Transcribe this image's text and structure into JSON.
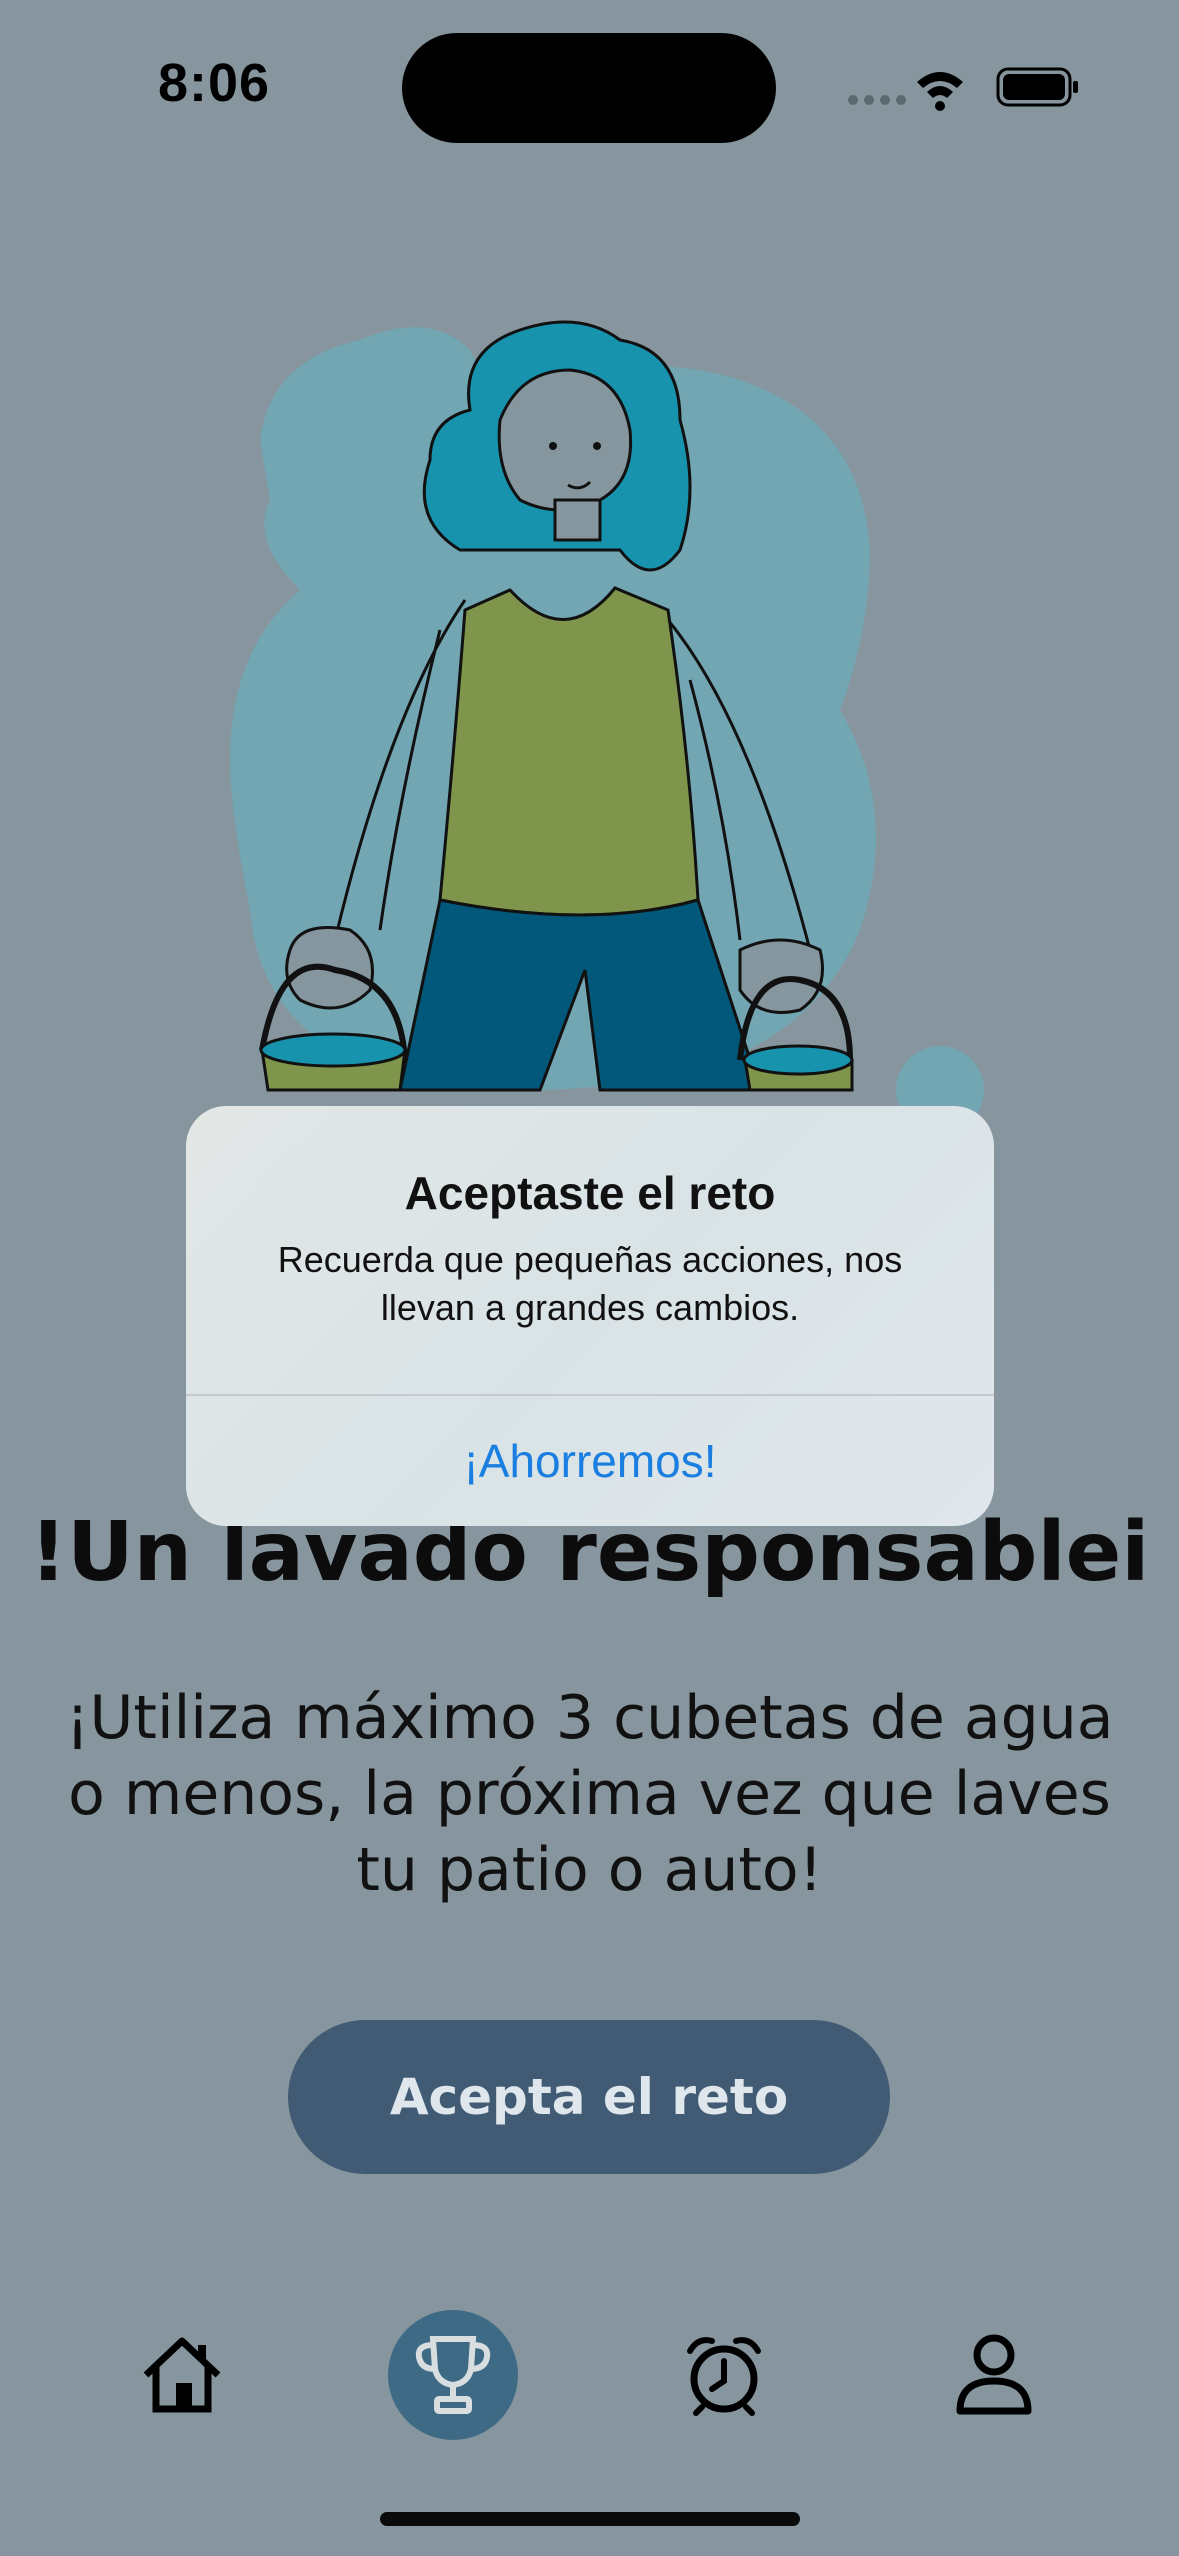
{
  "status_bar": {
    "time": "8:06",
    "icons": [
      "signal-icon",
      "wifi-icon",
      "battery-icon"
    ]
  },
  "screen": {
    "title": "!Un lavado responsablei",
    "body": "¡Utiliza máximo 3 cubetas de agua o menos, la próxima vez que laves tu patio o auto!",
    "cta_label": "Acepta el reto"
  },
  "alert": {
    "title": "Aceptaste el reto",
    "message": "Recuerda que pequeñas acciones, nos llevan a grandes cambios.",
    "button_label": "¡Ahorremos!"
  },
  "tab_bar": {
    "items": [
      {
        "icon": "home-icon",
        "active": false
      },
      {
        "icon": "trophy-icon",
        "active": true
      },
      {
        "icon": "alarm-clock-icon",
        "active": false
      },
      {
        "icon": "person-icon",
        "active": false
      }
    ]
  },
  "colors": {
    "background": "#87969e",
    "cta_button": "#405b73",
    "tab_active": "#3f6a85",
    "alert_button_text": "#1a7fe0"
  }
}
